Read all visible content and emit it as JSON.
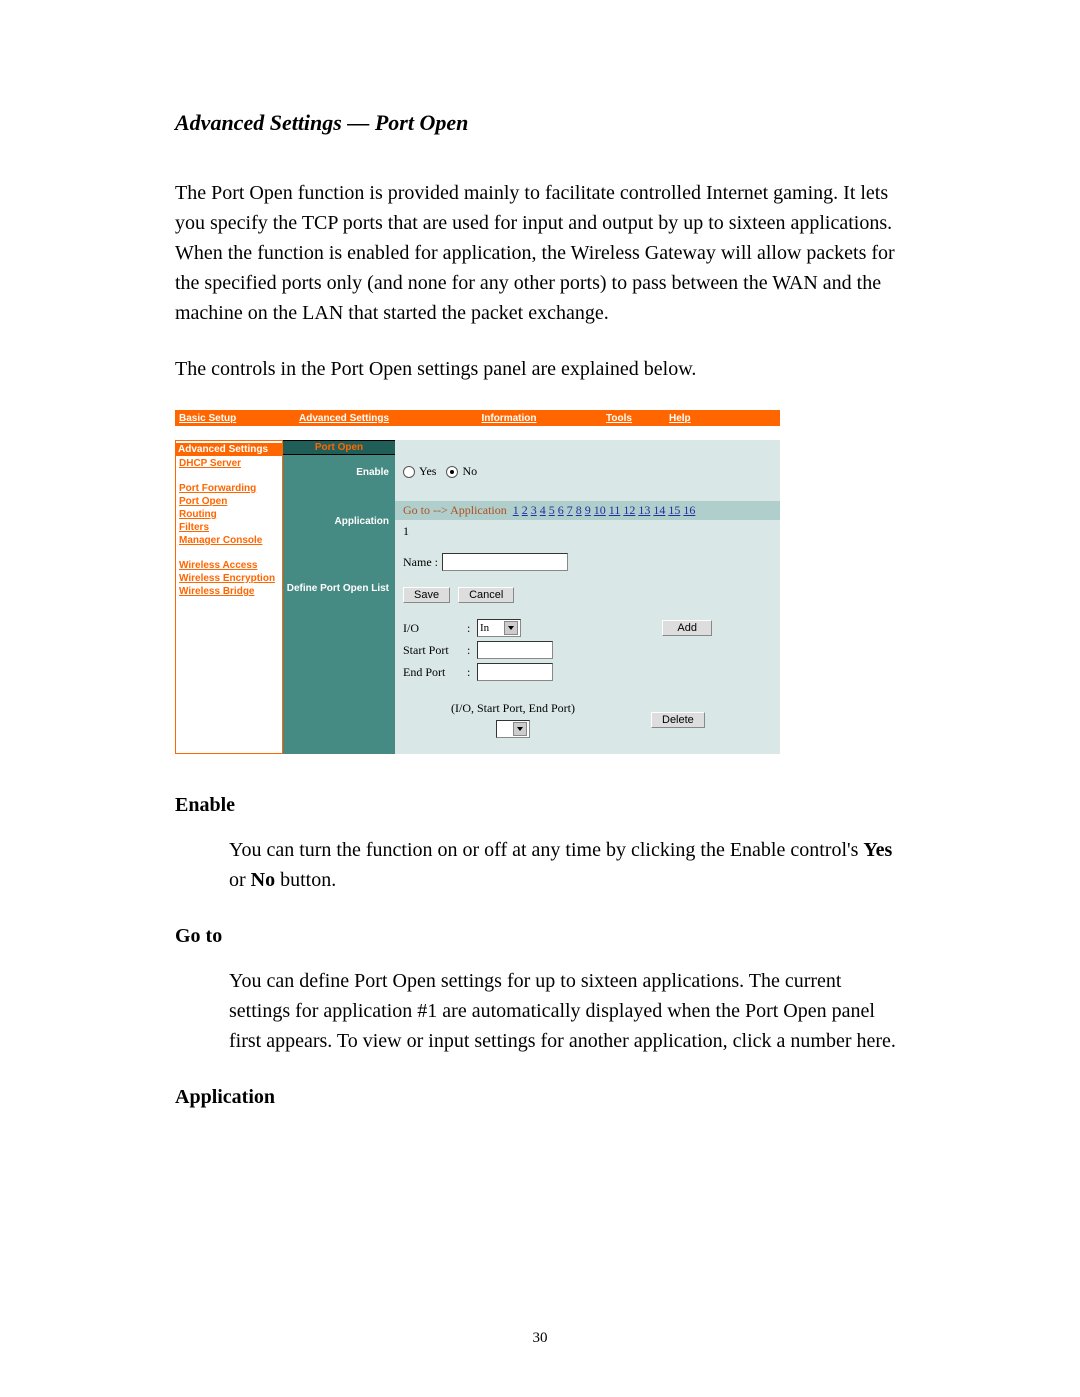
{
  "heading": "Advanced Settings — Port Open",
  "para1": "The Port Open function is provided mainly to facilitate controlled Internet gaming. It lets you specify the TCP ports that are used for input and output by up to sixteen applications. When the function is enabled for application, the Wireless Gateway will allow packets for the specified ports only (and none for any other ports) to pass between the WAN and the machine on the LAN that started the packet exchange.",
  "para2": "The controls in the Port Open settings panel are explained below.",
  "nav": {
    "basic": "Basic Setup",
    "adv": "Advanced Settings",
    "info": "Information",
    "tools": "Tools",
    "help": "Help"
  },
  "sidebar": {
    "title": "Advanced Settings",
    "dhcp": "DHCP Server",
    "portfwd": "Port Forwarding",
    "portopen": "Port Open",
    "routing": "Routing",
    "filters": "Filters",
    "mgr": "Manager Console",
    "wa": "Wireless Access",
    "we": "Wireless Encryption",
    "wb": "Wireless Bridge"
  },
  "teal": {
    "title": "Port Open",
    "enable": "Enable",
    "application": "Application",
    "define": "Define Port Open List"
  },
  "content": {
    "yes": "Yes",
    "no": "No",
    "enable_selected": "No",
    "goto_prefix": "Go to --> Application",
    "app_links": [
      "1",
      "2",
      "3",
      "4",
      "5",
      "6",
      "7",
      "8",
      "9",
      "10",
      "11",
      "12",
      "13",
      "14",
      "15",
      "16"
    ],
    "app_number": "1",
    "name_label": "Name :",
    "name_value": "",
    "save": "Save",
    "cancel": "Cancel",
    "io_label": "I/O",
    "io_value": "In",
    "startport_label": "Start Port",
    "startport_value": "",
    "endport_label": "End Port",
    "endport_value": "",
    "add": "Add",
    "entry_caption": "(I/O, Start Port, End Port)",
    "delete": "Delete"
  },
  "sections": {
    "enable_h": "Enable",
    "enable_body_pre": "You can turn the function on or off at any time by clicking the Enable control's ",
    "enable_yes": "Yes",
    "enable_or": " or ",
    "enable_no": "No",
    "enable_body_post": " button.",
    "goto_h": "Go to",
    "goto_body": "You can define Port Open settings for up to sixteen applications. The current settings for application #1 are automatically displayed when the Port Open panel first appears. To view or input settings for another application, click a number here.",
    "app_h": "Application"
  },
  "page_number": "30"
}
